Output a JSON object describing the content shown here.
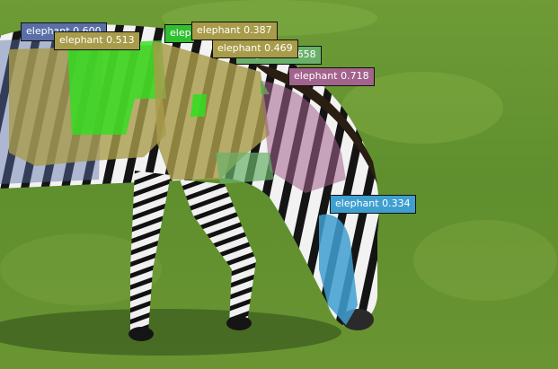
{
  "detections": [
    {
      "label": "elephant",
      "score": "0.600",
      "color": "#5a6fa8"
    },
    {
      "label": "elephant",
      "score": "0.513",
      "color": "#a89b4a"
    },
    {
      "label": "elephant",
      "score": "0.387",
      "color": "#a89b4a"
    },
    {
      "label": "elephant",
      "score": "0.469",
      "color": "#a89b4a"
    },
    {
      "label": "elephant",
      "score": "0.658",
      "color": "#6ab06a"
    },
    {
      "label": "elephant",
      "score": "0.718",
      "color": "#a2638c"
    },
    {
      "label": "elephant",
      "score": "0.334",
      "color": "#3f9fd0"
    },
    {
      "label": "elephant",
      "score": "",
      "color": "#2fbf2f"
    }
  ]
}
